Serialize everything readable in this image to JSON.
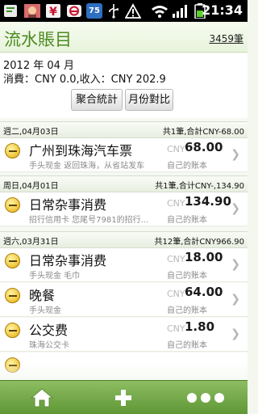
{
  "status_bar": {
    "time": "21:34",
    "badge_count": "75",
    "icons": [
      "notification-icon",
      "photo-icon",
      "yen-icon",
      "voicemail-icon",
      "badge-icon",
      "usb-icon",
      "warning-icon",
      "wifi-icon",
      "signal-icon",
      "battery-icon"
    ]
  },
  "header": {
    "title": "流水賬目",
    "count_label": "3459筆"
  },
  "summary": {
    "period": "2012 年 04 月",
    "totals": "消費：CNY 0.0,收入：CNY 202.9",
    "buttons": {
      "aggregate": "聚合統計",
      "monthly_compare": "月份對比"
    }
  },
  "groups": [
    {
      "date": "週二,04月03日",
      "summary": "共1筆,合計CNY-68.00",
      "items": [
        {
          "title": "广州到珠海汽车票",
          "currency": "CNY",
          "amount": "68.00",
          "subtitle": "手头现金 返回珠海，从省站发车",
          "book": "自己的账本"
        }
      ]
    },
    {
      "date": "周日,04月01日",
      "summary": "共1筆,合计CNY-,134.90",
      "items": [
        {
          "title": "日常杂事消费",
          "currency": "CNY",
          "amount": "134.90",
          "subtitle": "招行信用卡 您尾号7981的招行...",
          "book": "自己的账本"
        }
      ]
    },
    {
      "date": "週六,03月31日",
      "summary": "共12筆,合計CNY966.90",
      "items": [
        {
          "title": "日常杂事消费",
          "currency": "CNY",
          "amount": "18.00",
          "subtitle": "手头现金 毛巾",
          "book": "自己的账本"
        },
        {
          "title": "晚餐",
          "currency": "CNY",
          "amount": "64.00",
          "subtitle": "手头现金",
          "book": "自己的账本"
        },
        {
          "title": "公交费",
          "currency": "CNY",
          "amount": "1.80",
          "subtitle": "珠海公交卡",
          "book": "自己的账本"
        }
      ]
    }
  ],
  "bottom_bar": {
    "icons": [
      "home-icon",
      "add-icon",
      "more-icon"
    ]
  },
  "colors": {
    "accent": "#4a8a1e",
    "bottom_bar": "#6fa845",
    "entry_icon": "#f0c73a"
  }
}
